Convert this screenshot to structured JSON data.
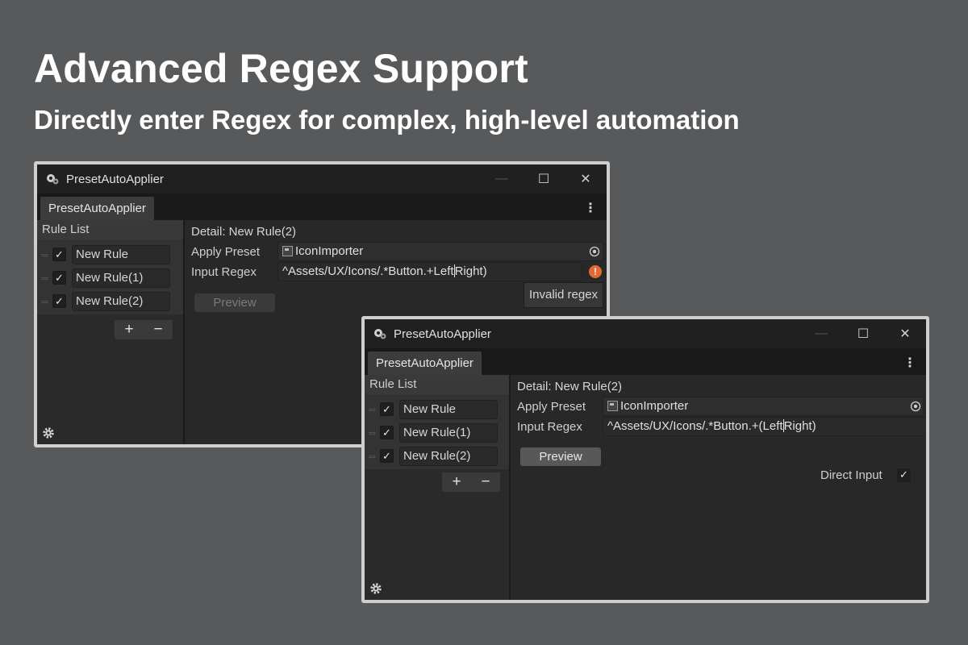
{
  "headline": "Advanced Regex Support",
  "subheadline": "Directly enter Regex for complex, high-level automation",
  "window_a": {
    "title": "PresetAutoApplier",
    "tab_label": "PresetAutoApplier",
    "rule_list_header": "Rule List",
    "rules": [
      "New Rule",
      "New Rule(1)",
      "New Rule(2)"
    ],
    "add_label": "+",
    "remove_label": "−",
    "detail_title": "Detail: New Rule(2)",
    "apply_preset_label": "Apply Preset",
    "apply_preset_value": "IconImporter",
    "input_regex_label": "Input Regex",
    "input_regex_before_caret": "^Assets/UX/Icons/.*Button.+Left",
    "input_regex_after_caret": "Right)",
    "error_tooltip": "Invalid regex",
    "preview_label": "Preview"
  },
  "window_b": {
    "title": "PresetAutoApplier",
    "tab_label": "PresetAutoApplier",
    "rule_list_header": "Rule List",
    "rules": [
      "New Rule",
      "New Rule(1)",
      "New Rule(2)"
    ],
    "add_label": "+",
    "remove_label": "−",
    "detail_title": "Detail: New Rule(2)",
    "apply_preset_label": "Apply Preset",
    "apply_preset_value": "IconImporter",
    "input_regex_label": "Input Regex",
    "input_regex_before_caret": "^Assets/UX/Icons/.*Button.+(Left",
    "input_regex_after_caret": "Right)",
    "preview_label": "Preview",
    "direct_input_label": "Direct Input"
  },
  "glyphs": {
    "minimize": "—",
    "maximize": "☐",
    "close": "✕",
    "kebab": "⋮",
    "check": "✓",
    "warning": "!"
  },
  "colors": {
    "background": "#58595b",
    "window_bg": "#282828",
    "warning": "#e56a32"
  }
}
